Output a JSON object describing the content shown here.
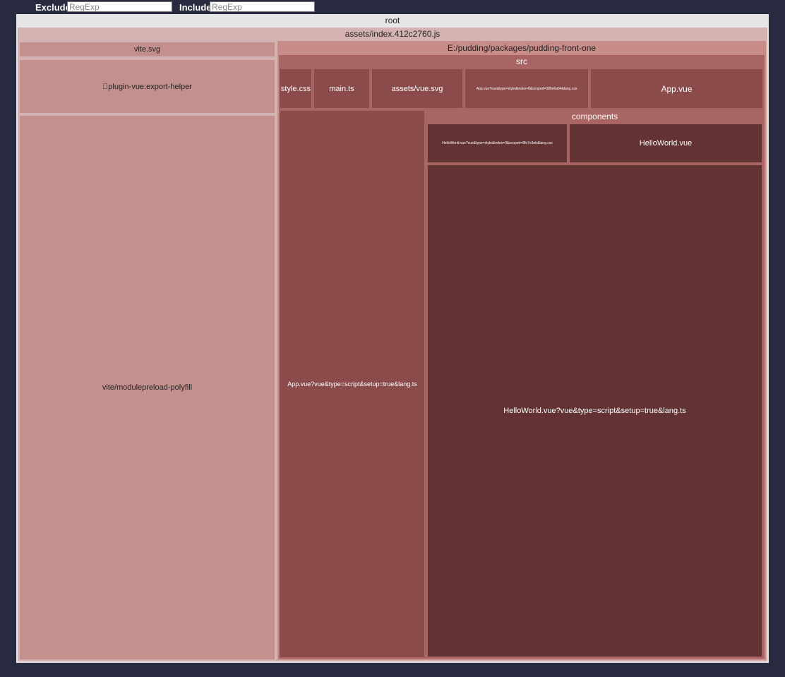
{
  "toolbar": {
    "exclude_label": "Exclude",
    "exclude_placeholder": "RegExp",
    "include_label": "Include",
    "include_placeholder": "RegExp"
  },
  "treemap": {
    "root": "root",
    "bundle": "assets/index.412c2760.js",
    "vite_svg": "vite.svg",
    "export_helper": "\u0000plugin-vue:export-helper",
    "modulepreload": "vite/modulepreload-polyfill",
    "package": "E:/pudding/packages/pudding-front-one",
    "src": "src",
    "style_css": "style.css",
    "main_ts": "main.ts",
    "vue_svg": "assets/vue.svg",
    "app_style": "App.vue?vue&type=style&index=0&scoped=085e6a54&lang.css",
    "app_vue": "App.vue",
    "app_script": "App.vue?vue&type=script&setup=true&lang.ts",
    "components": "components",
    "hello_style": "HelloWorld.vue?vue&type=style&index=0&scoped=8fe7e3eb&lang.css",
    "hello_vue": "HelloWorld.vue",
    "hello_script": "HelloWorld.vue?vue&type=script&setup=true&lang.ts"
  },
  "colors": {
    "background": "#282b40",
    "root_header": "#e6e6e6",
    "bundle_header": "#d6b3b3",
    "vendor_cell": "#c3908d",
    "package_header": "#c88c89",
    "src_header": "#a86563",
    "src_cell": "#8b4b4b",
    "components_cell": "#633333"
  }
}
